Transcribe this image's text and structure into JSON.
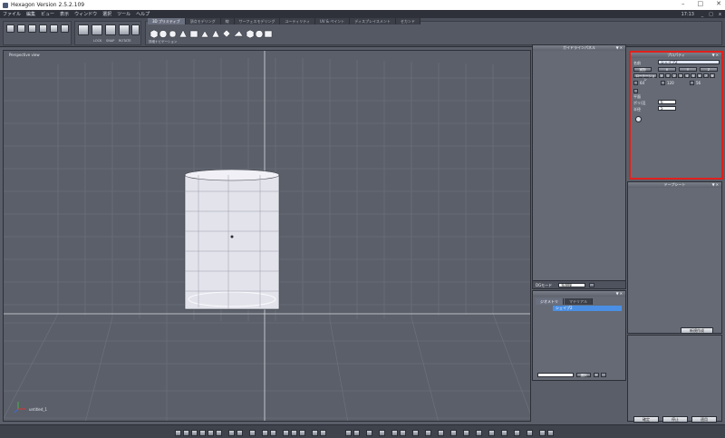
{
  "window": {
    "title": "Hexagon Version 2.5.2.109",
    "clock": "17:13"
  },
  "menu": [
    "ファイル",
    "編集",
    "ビュー",
    "表示",
    "ウィンドウ",
    "選択",
    "ツール",
    "ヘルプ"
  ],
  "toolbar": {
    "coord_select": "ワールド",
    "chips": {
      "xyz": "XYZ",
      "omni": "OMNI"
    },
    "sub_labels": {
      "lock": "LOCK",
      "snap": "SNAP",
      "rotate": "ROTATE"
    },
    "tabs": [
      "3D プリミティブ",
      "頂点モデリング",
      "線",
      "サーフェスモデリング",
      "ユーティリティ",
      "UV & ペイント",
      "ディスプレイスメント",
      "セカンド"
    ],
    "sub_group_label": "詳細ナビゲーション"
  },
  "viewport": {
    "label": "Perspective view",
    "object_label": "untitled_1"
  },
  "panels": {
    "top_middle": {
      "title": "ガイドラインパネル"
    },
    "properties": {
      "title": "プロパティ",
      "name_label": "名前",
      "name_value": "シェイプ2",
      "actual_label": "実物",
      "axes": [
        "X",
        "Y",
        "Z"
      ],
      "rotation_label": "ローテーション",
      "rot_numbers": [
        "0",
        "1",
        "2",
        "3",
        "4",
        "5",
        "6",
        "7",
        "8"
      ],
      "values": [
        "64",
        "120",
        "56"
      ],
      "flag_label": "平面",
      "speed_label": "ポリ/辺",
      "speed_value": "6",
      "size_label": "半径",
      "size_value": "5"
    },
    "layers": {
      "title": "ドープシート",
      "add_btn": "新規作成"
    },
    "dg_label": "DGモード",
    "dg_value": "多規模",
    "scene_tabs": [
      "ジオメトリ",
      "マテリアル"
    ],
    "scene_item": "シェイプ2",
    "select_btn": "選択",
    "bottom_buttons": [
      "確定",
      "停止",
      "適用"
    ]
  }
}
